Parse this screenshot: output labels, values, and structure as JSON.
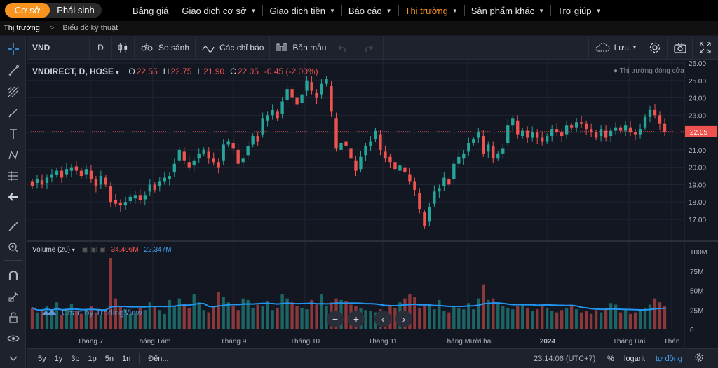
{
  "topnav": {
    "seg_on": "Cơ sở",
    "seg_off": "Phái sinh",
    "menu": [
      {
        "label": "Bảng giá",
        "caret": false,
        "active": false
      },
      {
        "label": "Giao dịch cơ sở",
        "caret": true,
        "active": false
      },
      {
        "label": "Giao dịch tiền",
        "caret": true,
        "active": false
      },
      {
        "label": "Báo cáo",
        "caret": true,
        "active": false
      },
      {
        "label": "Thị trường",
        "caret": true,
        "active": true
      },
      {
        "label": "Sản phẩm khác",
        "caret": true,
        "active": false
      },
      {
        "label": "Trợ giúp",
        "caret": true,
        "active": false
      }
    ]
  },
  "breadcrumb": {
    "root": "Thị trường",
    "sep": ">",
    "current": "Biểu đồ kỹ thuật"
  },
  "toolbar": {
    "symbol": "VND",
    "interval": "D",
    "compare": "So sánh",
    "indicators": "Các chỉ báo",
    "templates": "Bản mẫu",
    "save": "Lưu"
  },
  "legend": {
    "name": "VNDIRECT, D, HOSE",
    "o_key": "O",
    "o": "22.55",
    "h_key": "H",
    "h": "22.75",
    "l_key": "L",
    "l": "21.90",
    "c_key": "C",
    "c": "22.05",
    "change": "-0.45 (-2.00%)",
    "market_status": "Thị trường đóng cửa"
  },
  "volume_legend": {
    "name": "Volume (20)",
    "v1": "34.406M",
    "v2": "22.347M"
  },
  "watermark": "Chart by TradingView",
  "bottom": {
    "ranges": [
      "5y",
      "1y",
      "3p",
      "1p",
      "5n",
      "1n"
    ],
    "goto": "Đến...",
    "time": "23:14:06 (UTC+7)",
    "pct": "%",
    "log": "logarit",
    "auto": "tự động"
  },
  "colors": {
    "up": "#26a69a",
    "down": "#ef5350",
    "bg": "#131722",
    "accent": "#f7931e"
  },
  "chart_data": {
    "type": "candlestick",
    "price_axis": [
      "26.00",
      "25.00",
      "24.00",
      "23.00",
      "22.00",
      "21.00",
      "20.00",
      "19.00",
      "18.00",
      "17.00"
    ],
    "last_price": "22.05",
    "volume_axis": [
      "100M",
      "75M",
      "50M",
      "25M",
      "0"
    ],
    "x_labels": [
      "Tháng 7",
      "Tháng Tám",
      "Tháng 9",
      "Tháng 10",
      "Tháng 11",
      "Tháng Mười hai",
      "2024",
      "Tháng Hai",
      "Thán"
    ],
    "closes": [
      18.9,
      19.3,
      19.0,
      19.4,
      19.6,
      19.8,
      19.4,
      19.9,
      20.0,
      19.8,
      19.5,
      19.9,
      19.3,
      18.9,
      19.5,
      19.0,
      18.0,
      17.9,
      17.8,
      18.0,
      18.3,
      18.4,
      18.1,
      18.4,
      19.0,
      18.7,
      19.2,
      19.4,
      19.5,
      20.2,
      21.0,
      20.4,
      20.0,
      20.4,
      20.8,
      21.0,
      20.5,
      20.3,
      20.0,
      21.3,
      21.5,
      21.1,
      20.2,
      20.5,
      21.2,
      21.8,
      21.5,
      22.8,
      23.0,
      23.3,
      22.8,
      23.8,
      24.5,
      24.0,
      23.6,
      24.2,
      25.0,
      24.4,
      24.0,
      24.8,
      25.1,
      23.2,
      21.1,
      21.4,
      21.2,
      20.5,
      19.8,
      20.6,
      21.2,
      21.5,
      22.1,
      21.0,
      20.5,
      20.3,
      19.9,
      20.1,
      19.7,
      19.2,
      18.7,
      17.6,
      16.6,
      17.7,
      18.6,
      18.8,
      19.4,
      19.0,
      20.2,
      20.6,
      20.8,
      21.4,
      21.6,
      22.0,
      20.8,
      21.3,
      20.5,
      20.8,
      21.1,
      22.4,
      22.8,
      21.9,
      22.1,
      21.7,
      22.0,
      21.7,
      21.5,
      21.8,
      22.2,
      22.0,
      21.8,
      22.4,
      22.3,
      22.6,
      22.5,
      22.2,
      22.0,
      21.7,
      22.2,
      21.7,
      22.1,
      22.3,
      22.1,
      22.4,
      22.0,
      21.9,
      22.2,
      22.9,
      23.3,
      23.0,
      22.5,
      22.05
    ],
    "volumes": [
      28,
      22,
      25,
      30,
      20,
      35,
      18,
      27,
      33,
      24,
      20,
      26,
      30,
      22,
      18,
      25,
      92,
      40,
      30,
      26,
      20,
      22,
      28,
      25,
      35,
      30,
      25,
      20,
      38,
      30,
      40,
      33,
      28,
      45,
      35,
      25,
      22,
      30,
      48,
      42,
      35,
      30,
      25,
      40,
      38,
      28,
      32,
      30,
      36,
      25,
      28,
      45,
      40,
      35,
      30,
      28,
      26,
      38,
      32,
      45,
      30,
      35,
      40,
      38,
      36,
      32,
      30,
      28,
      25,
      24,
      22,
      26,
      20,
      30,
      28,
      35,
      40,
      45,
      42,
      28,
      33,
      30,
      26,
      38,
      24,
      22,
      30,
      28,
      26,
      34,
      26,
      40,
      58,
      38,
      40,
      34,
      30,
      28,
      26,
      30,
      32,
      28,
      24,
      26,
      30,
      28,
      24,
      22,
      25,
      28,
      30,
      26,
      22,
      24,
      20,
      25,
      22,
      28,
      34,
      32,
      22,
      25,
      20,
      22,
      26,
      28,
      32,
      40,
      35,
      30,
      34
    ]
  }
}
